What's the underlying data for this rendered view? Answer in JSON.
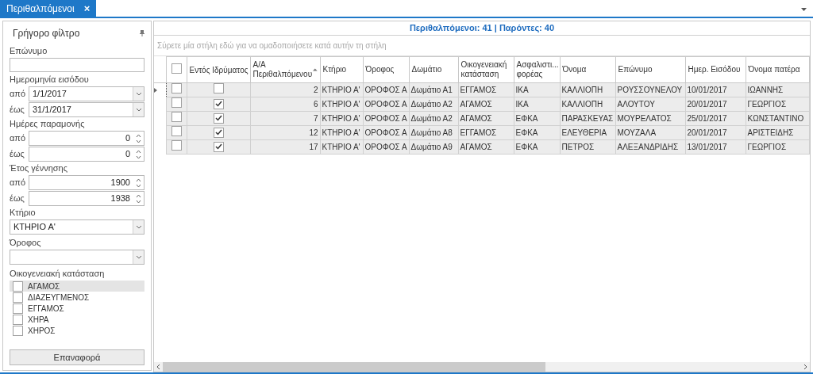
{
  "tabs": [
    {
      "label": "Περιθαλπόμενοι",
      "selected": true,
      "close": "×"
    }
  ],
  "filter": {
    "title": "Γρήγορο φίλτρο",
    "surname": {
      "label": "Επώνυμο"
    },
    "entry_date": {
      "label": "Ημερομηνία εισόδου",
      "from_label": "από",
      "from": "1/1/2017",
      "to_label": "έως",
      "to": "31/1/2017"
    },
    "stay_days": {
      "label": "Ημέρες παραμονής",
      "from_label": "από",
      "from": "0",
      "to_label": "έως",
      "to": "0"
    },
    "birth_year": {
      "label": "Έτος γέννησης",
      "from_label": "από",
      "from": "1900",
      "to_label": "έως",
      "to": "1938"
    },
    "building": {
      "label": "Κτήριο",
      "value": "ΚΤΗΡΙΟ Α'"
    },
    "floor": {
      "label": "Όροφος"
    },
    "marital": {
      "label": "Οικογενειακή κατάσταση",
      "options": [
        {
          "label": "ΑΓΑΜΟΣ",
          "checked": false,
          "selected": true
        },
        {
          "label": "ΔΙΑΖΕΥΓΜΕΝΟΣ",
          "checked": false,
          "selected": false
        },
        {
          "label": "ΕΓΓΑΜΟΣ",
          "checked": false,
          "selected": false
        },
        {
          "label": "ΧΗΡΑ",
          "checked": false,
          "selected": false
        },
        {
          "label": "ΧΗΡΟΣ",
          "checked": false,
          "selected": false
        }
      ]
    },
    "reset": "Επαναφορά"
  },
  "summary": "Περιθαλπόμενοι: 41 | Παρόντες: 40",
  "group_hint": "Σύρετε μία στήλη εδώ για να ομαδοποιήσετε κατά αυτήν τη στήλη",
  "table": {
    "in_facility_header": "Εντός Ιδρύματος",
    "columns": [
      "Α/Α Περιθαλπόμενου",
      "Κτήριο",
      "Όροφος",
      "Δωμάτιο",
      "Οικογενειακή κατάσταση",
      "Ασφαλιστι... φορέας",
      "Όνομα",
      "Επώνυμο",
      "Ημερ. Εισόδου",
      "Όνομα πατέρα"
    ],
    "header_checked": false,
    "rows": [
      {
        "current": true,
        "checked": false,
        "in_facility": false,
        "cells": [
          "2",
          "ΚΤΗΡΙΟ Α'",
          "ΟΡΟΦΟΣ Α",
          "Δωμάτιο Α1",
          "ΕΓΓΑΜΟΣ",
          "ΙΚΑ",
          "ΚΑΛΛΙΟΠΗ",
          "ΡΟΥΣΣΟΥΝΕΛΟΥ",
          "10/01/2017",
          "ΙΩΑΝΝΗΣ"
        ]
      },
      {
        "current": false,
        "checked": false,
        "in_facility": true,
        "cells": [
          "6",
          "ΚΤΗΡΙΟ Α'",
          "ΟΡΟΦΟΣ Α",
          "Δωμάτιο Α2",
          "ΑΓΑΜΟΣ",
          "ΙΚΑ",
          "ΚΑΛΛΙΟΠΗ",
          "ΑΛΟΥΤΟΥ",
          "20/01/2017",
          "ΓΕΩΡΓΙΟΣ"
        ]
      },
      {
        "current": false,
        "checked": false,
        "in_facility": true,
        "cells": [
          "7",
          "ΚΤΗΡΙΟ Α'",
          "ΟΡΟΦΟΣ Α",
          "Δωμάτιο Α2",
          "ΑΓΑΜΟΣ",
          "ΕΦΚΑ",
          "ΠΑΡΑΣΚΕΥΑΣ",
          "ΜΟΥΡΕΛΑΤΟΣ",
          "25/01/2017",
          "ΚΩΝΣΤΑΝΤΙΝΟ"
        ]
      },
      {
        "current": false,
        "checked": false,
        "in_facility": true,
        "cells": [
          "12",
          "ΚΤΗΡΙΟ Α'",
          "ΟΡΟΦΟΣ Α",
          "Δωμάτιο Α8",
          "ΕΓΓΑΜΟΣ",
          "ΕΦΚΑ",
          "ΕΛΕΥΘΕΡΙΑ",
          "ΜΟΥΖΑΛΑ",
          "20/01/2017",
          "ΑΡΙΣΤΕΙΔΗΣ"
        ]
      },
      {
        "current": false,
        "checked": false,
        "in_facility": true,
        "cells": [
          "17",
          "ΚΤΗΡΙΟ Α'",
          "ΟΡΟΦΟΣ Α",
          "Δωμάτιο Α9",
          "ΑΓΑΜΟΣ",
          "ΕΦΚΑ",
          "ΠΕΤΡΟΣ",
          "ΑΛΕΞΑΝΔΡΙΔΗΣ",
          "13/01/2017",
          "ΓΕΩΡΓΙΟΣ"
        ]
      }
    ]
  }
}
